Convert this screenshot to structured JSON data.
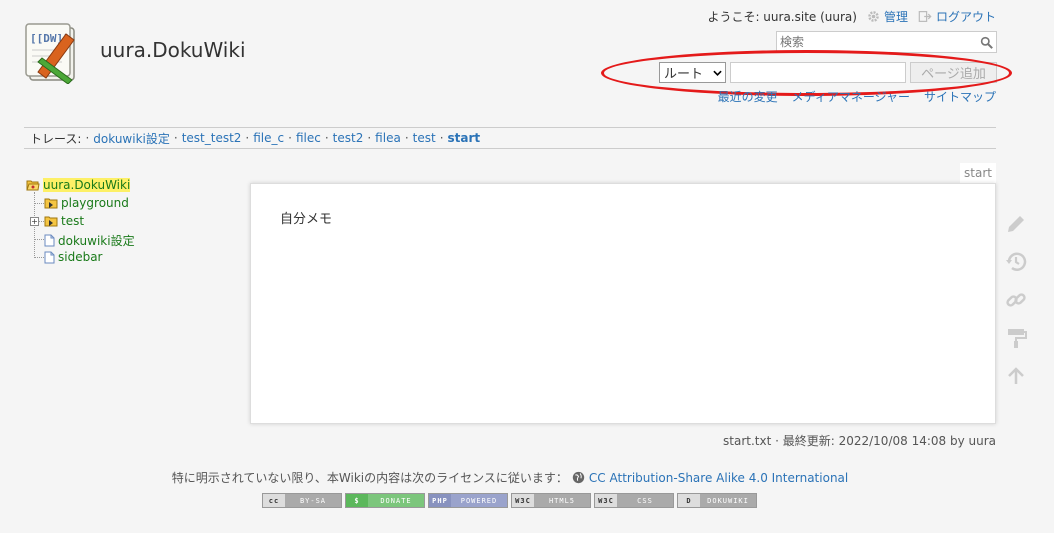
{
  "header": {
    "site_title": "uura.DokuWiki",
    "welcome": "ようこそ: uura.site (uura)",
    "admin_label": "管理",
    "logout_label": "ログアウト",
    "search_placeholder": "検索",
    "newpage": {
      "namespace_selected": "ルート",
      "page_name_value": "",
      "add_button": "ページ追加"
    },
    "site_tools": [
      "最近の変更",
      "メディアマネージャー",
      "サイトマップ"
    ]
  },
  "breadcrumbs": {
    "label": "トレース:",
    "items": [
      "dokuwiki設定",
      "test_test2",
      "file_c",
      "filec",
      "test2",
      "filea",
      "test"
    ],
    "current": "start"
  },
  "sidebar": {
    "tree": [
      {
        "label": "uura.DokuWiki",
        "type": "folder-open",
        "level": 0
      },
      {
        "label": "playground",
        "type": "folder",
        "level": 1
      },
      {
        "label": "test",
        "type": "folder",
        "level": 1,
        "collapsed": true
      },
      {
        "label": "dokuwiki設定",
        "type": "page",
        "level": 1
      },
      {
        "label": "sidebar",
        "type": "page",
        "level": 1
      }
    ]
  },
  "page": {
    "tab_label": "start",
    "content": "自分メモ"
  },
  "page_tools": [
    "pencil-icon",
    "history-icon",
    "backlinks-icon",
    "paint-roller-icon",
    "arrow-up-icon"
  ],
  "docinfo": "start.txt · 最終更新: 2022/10/08 14:08 by uura",
  "footer": {
    "license_text": "特に明示されていない限り、本Wikiの内容は次のライセンスに従います：",
    "license_link": "CC Attribution-Share Alike 4.0 International",
    "badges": [
      {
        "left": "cc",
        "right": "BY-SA"
      },
      {
        "left": "$",
        "right": "DONATE"
      },
      {
        "left": "PHP",
        "right": "POWERED"
      },
      {
        "left": "W3C",
        "right": "HTML5"
      },
      {
        "left": "W3C",
        "right": "CSS"
      },
      {
        "left": "D",
        "right": "DOKUWIKI"
      }
    ]
  },
  "colors": {
    "link": "#2b73b7",
    "tree_link": "#1a7a1a",
    "highlight": "#fdf066",
    "annotation": "#e41a1a"
  }
}
